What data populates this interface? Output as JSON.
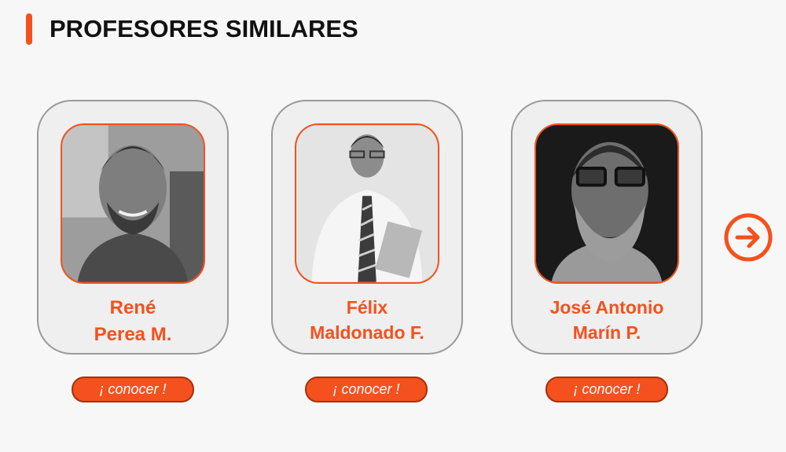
{
  "section": {
    "title": "PROFESORES SIMILARES"
  },
  "colors": {
    "accent": "#f4511e",
    "card_background": "#efefef",
    "card_border": "#9a9a9a",
    "title_text": "#111111"
  },
  "professors": [
    {
      "name_line1": "René",
      "name_line2": "Perea M.",
      "cta_label": "¡ conocer !"
    },
    {
      "name_line1": "Félix",
      "name_line2": "Maldonado F.",
      "cta_label": "¡ conocer !"
    },
    {
      "name_line1": "José Antonio",
      "name_line2": "Marín P.",
      "cta_label": "¡ conocer !"
    }
  ],
  "navigation": {
    "next_icon": "arrow-right-circle-icon"
  }
}
